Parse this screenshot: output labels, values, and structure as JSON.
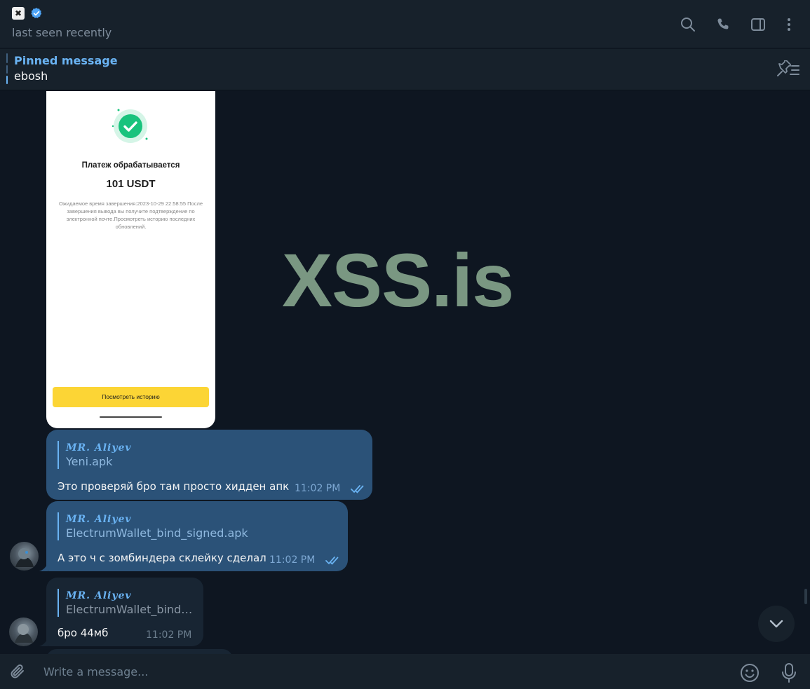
{
  "header": {
    "chat_icon_glyph": "✖",
    "status": "last seen recently"
  },
  "pinned": {
    "title": "Pinned message",
    "text": "ebosh"
  },
  "watermark": "XSS.is",
  "payment_image": {
    "title": "Платеж обрабатывается",
    "amount": "101 USDT",
    "note": "Ожидаемое время завершения:2023-10-29 22:58:55 После завершения вывода вы получите подтверждение по электронной почте.Просмотреть историю последних обновлений.",
    "button": "Посмотреть историю"
  },
  "messages": [
    {
      "reply_name": "MR. Aliyev",
      "reply_text": "Yeni.apk",
      "text": "Это проверяй бро там просто хидден апк",
      "time": "11:02 PM"
    },
    {
      "reply_name": "MR. Aliyev",
      "reply_text": "ElectrumWallet_bind_signed.apk",
      "text": "А это ч с зомбиндера склейку сделал",
      "time": "11:02 PM"
    },
    {
      "reply_name": "MR. Aliyev",
      "reply_text": "ElectrumWallet_bind_...",
      "text": "бро 44мб",
      "time": "11:02 PM"
    }
  ],
  "composer": {
    "placeholder": "Write a message..."
  },
  "colors": {
    "accent": "#6ab3f3",
    "outgoing_bubble": "#2b5278",
    "incoming_bubble": "#182533",
    "background": "#0e1621"
  },
  "icons": [
    "search-icon",
    "phone-icon",
    "sidebar-toggle-icon",
    "more-vertical-icon",
    "pin-list-icon",
    "check-circle-icon",
    "double-check-icon",
    "chevron-down-icon",
    "paperclip-icon",
    "emoji-icon",
    "microphone-icon"
  ]
}
